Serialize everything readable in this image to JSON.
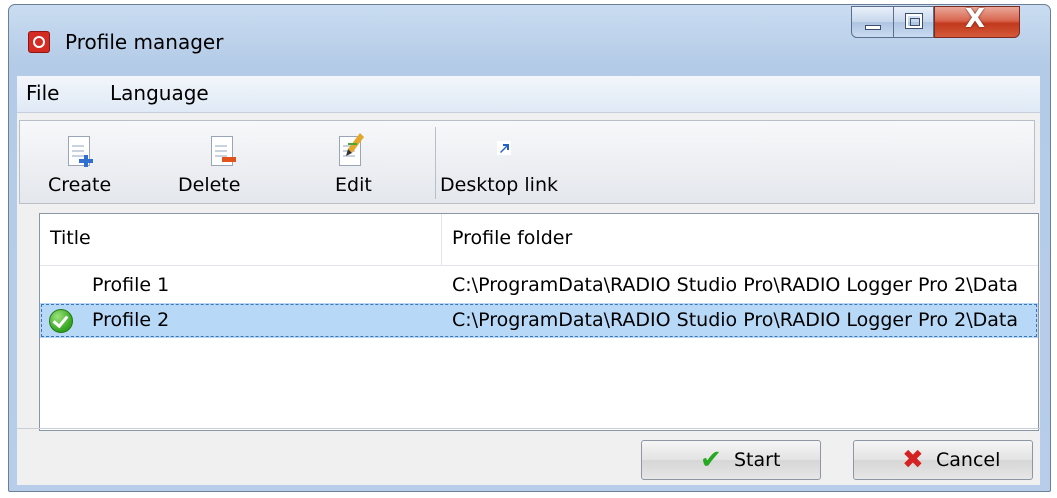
{
  "window": {
    "title": "Profile manager",
    "icons": {
      "app": "app-red-circle-icon",
      "minimize": "minimize-icon",
      "maximize": "maximize-icon",
      "close": "close-icon"
    },
    "close_glyph": "X"
  },
  "menu": [
    {
      "label": "File"
    },
    {
      "label": "Language"
    }
  ],
  "toolbar": {
    "create": {
      "label": "Create",
      "icon": "document-add-icon"
    },
    "delete": {
      "label": "Delete",
      "icon": "document-remove-icon"
    },
    "edit": {
      "label": "Edit",
      "icon": "document-edit-icon"
    },
    "desktop_link": {
      "label": "Desktop link",
      "icon": "shortcut-arrow-icon"
    }
  },
  "list": {
    "columns": [
      "Title",
      "Profile folder"
    ],
    "rows": [
      {
        "title": "Profile 1",
        "folder": "C:\\ProgramData\\RADIO Studio Pro\\RADIO Logger Pro 2\\Data",
        "active": false,
        "selected": false
      },
      {
        "title": "Profile 2",
        "folder": "C:\\ProgramData\\RADIO Studio Pro\\RADIO Logger Pro 2\\Data",
        "active": true,
        "selected": true
      }
    ]
  },
  "buttons": {
    "start": {
      "label": "Start",
      "icon": "check-icon"
    },
    "cancel": {
      "label": "Cancel",
      "icon": "cross-icon"
    }
  },
  "colors": {
    "selection": "#b7d9f7",
    "start_icon": "#27a822",
    "cancel_icon": "#d42222",
    "title_bar": "#b4cbe7"
  }
}
